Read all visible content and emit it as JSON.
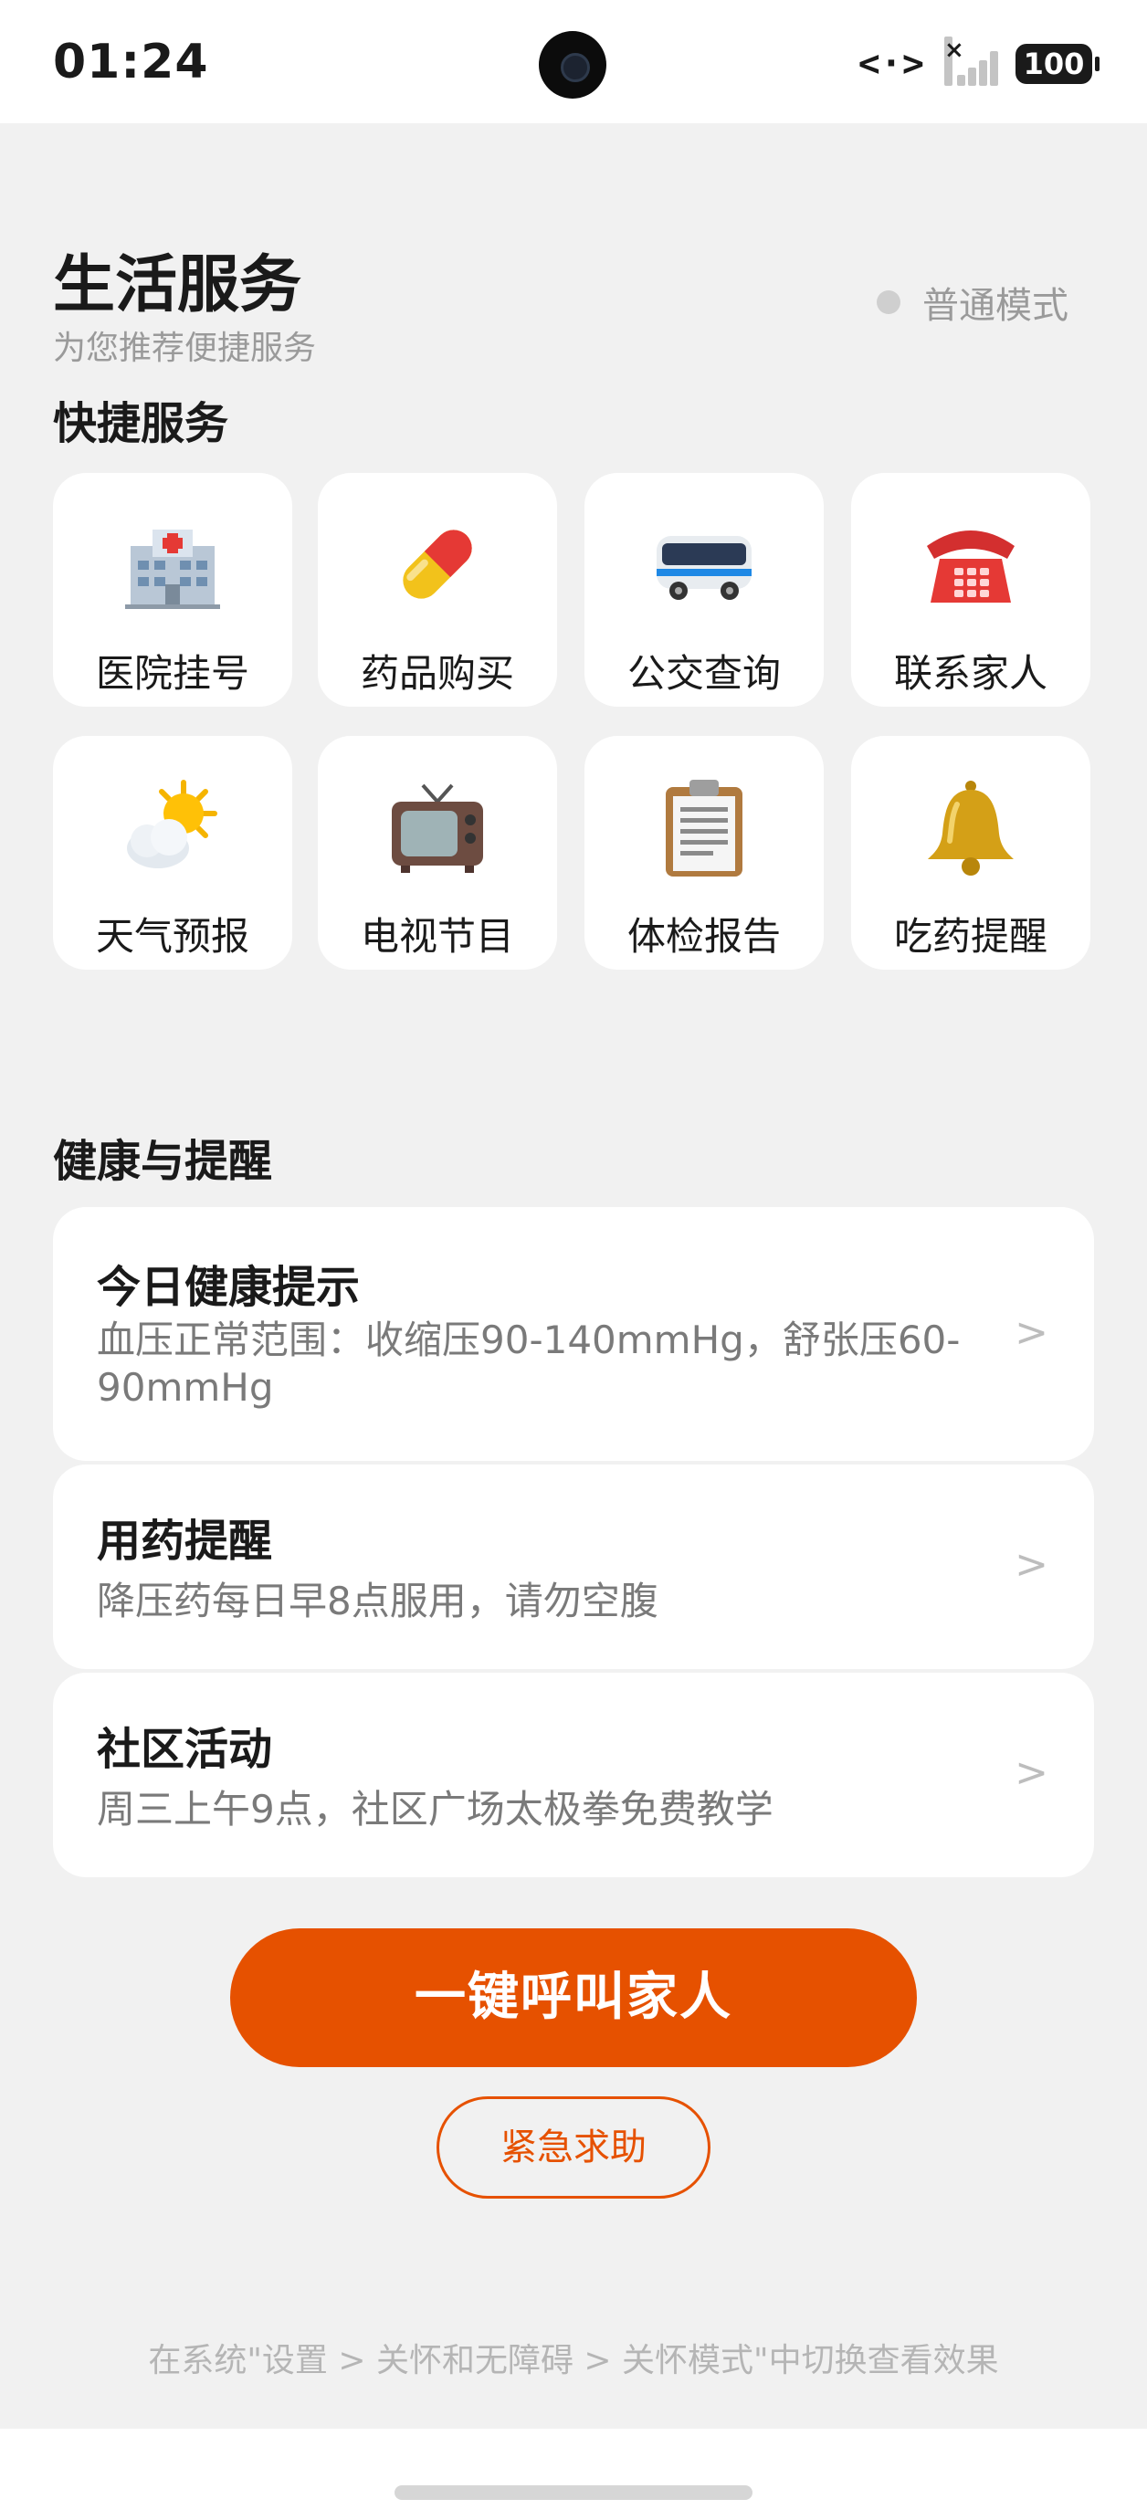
{
  "status_bar": {
    "time": "01:24",
    "battery": "100",
    "data_icon": "<·>"
  },
  "header": {
    "title": "生活服务",
    "subtitle": "为您推荐便捷服务",
    "mode_label": "普通模式"
  },
  "quick_services": {
    "title": "快捷服务",
    "items": [
      {
        "label": "医院挂号",
        "icon": "hospital-icon"
      },
      {
        "label": "药品购买",
        "icon": "pill-icon"
      },
      {
        "label": "公交查询",
        "icon": "bus-icon"
      },
      {
        "label": "联系家人",
        "icon": "telephone-icon"
      },
      {
        "label": "天气预报",
        "icon": "weather-icon"
      },
      {
        "label": "电视节目",
        "icon": "tv-icon"
      },
      {
        "label": "体检报告",
        "icon": "clipboard-icon"
      },
      {
        "label": "吃药提醒",
        "icon": "bell-icon"
      }
    ]
  },
  "health": {
    "title": "健康与提醒",
    "cards": [
      {
        "title": "今日健康提示",
        "desc": "血压正常范围：收缩压90-140mmHg，舒张压60-90mmHg",
        "chevron": ">"
      },
      {
        "title": "用药提醒",
        "desc": "降压药每日早8点服用，请勿空腹",
        "chevron": ">"
      },
      {
        "title": "社区活动",
        "desc": "周三上午9点，社区广场太极拳免费教学",
        "chevron": ">"
      }
    ]
  },
  "actions": {
    "call_family": "一键呼叫家人",
    "sos": "紧急求助"
  },
  "footer": {
    "tip": "在系统\"设置 > 关怀和无障碍 > 关怀模式\"中切换查看效果"
  },
  "colors": {
    "accent": "#e65100",
    "background": "#f1f1f1",
    "card": "#ffffff"
  }
}
